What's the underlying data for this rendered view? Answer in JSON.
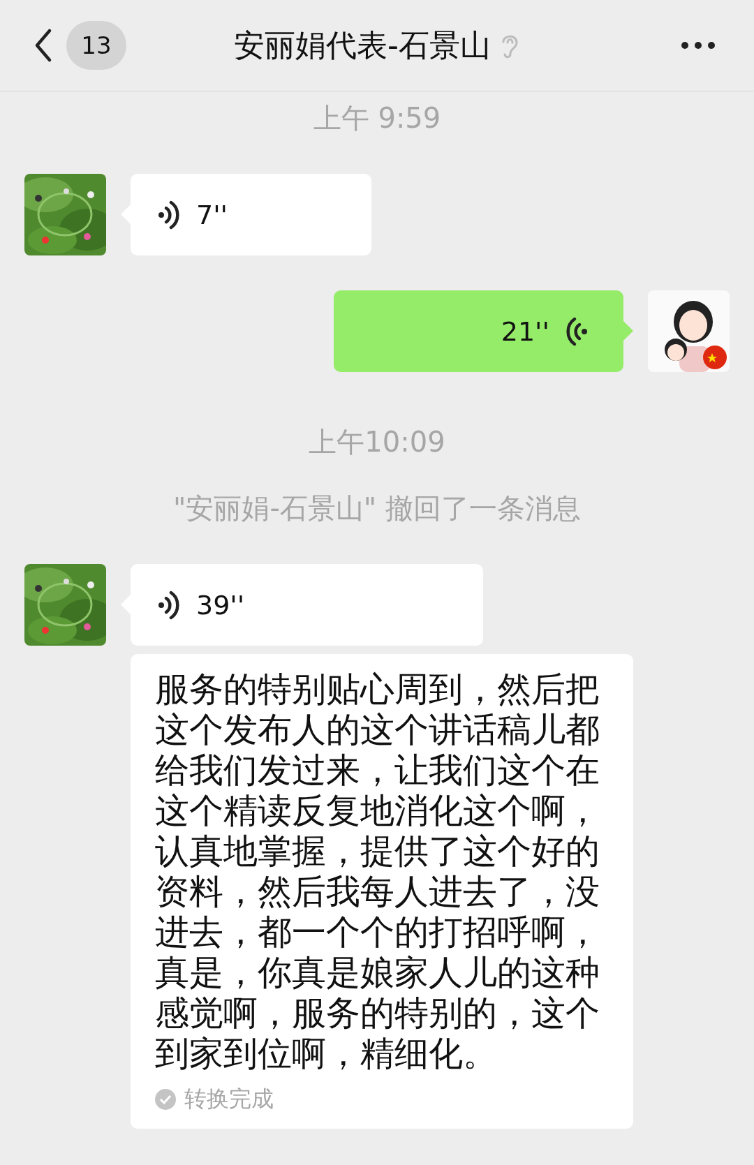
{
  "header": {
    "back_count": "13",
    "title": "安丽娟代表-石景山"
  },
  "messages": [
    {
      "kind": "time",
      "text": "上午 9:59"
    },
    {
      "kind": "voice",
      "outgoing": false,
      "duration": "7''"
    },
    {
      "kind": "voice",
      "outgoing": true,
      "duration": "21''"
    },
    {
      "kind": "time",
      "text": "上午10:09"
    },
    {
      "kind": "notice",
      "text": "\"安丽娟-石景山\" 撤回了一条消息"
    },
    {
      "kind": "voice",
      "outgoing": false,
      "duration": "39''",
      "transcript": {
        "text": "服务的特别贴心周到，然后把这个发布人的这个讲话稿儿都给我们发过来，让我们这个在这个精读反复地消化这个啊，认真地掌握，提供了这个好的资料，然后我每人进去了，没进去，都一个个的打招呼啊，真是，你真是娘家人儿的这种感觉啊，服务的特别的，这个到家到位啊，精细化。",
        "status": "转换完成"
      }
    }
  ]
}
